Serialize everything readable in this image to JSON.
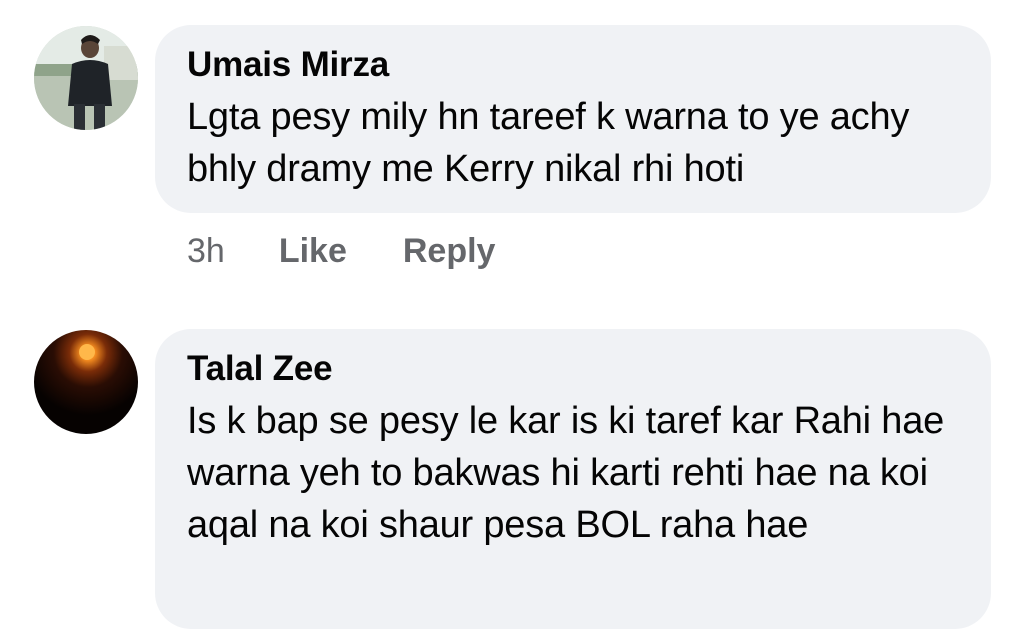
{
  "comments": [
    {
      "author": "Umais Mirza",
      "text": "Lgta pesy mily hn tareef k warna to ye achy bhly dramy me Kerry nikal rhi hoti",
      "time": "3h",
      "like_label": "Like",
      "reply_label": "Reply",
      "avatar_icon": "profile-photo-person"
    },
    {
      "author": "Talal Zee",
      "text": "Is k bap se pesy le kar is ki taref kar Rahi hae warna yeh to bakwas hi karti rehti hae na koi aqal na koi shaur pesa BOL raha hae",
      "avatar_icon": "profile-photo-sun"
    }
  ],
  "colors": {
    "bubble_bg": "#f0f2f5",
    "text": "#050505",
    "secondary_text": "#65676b"
  }
}
